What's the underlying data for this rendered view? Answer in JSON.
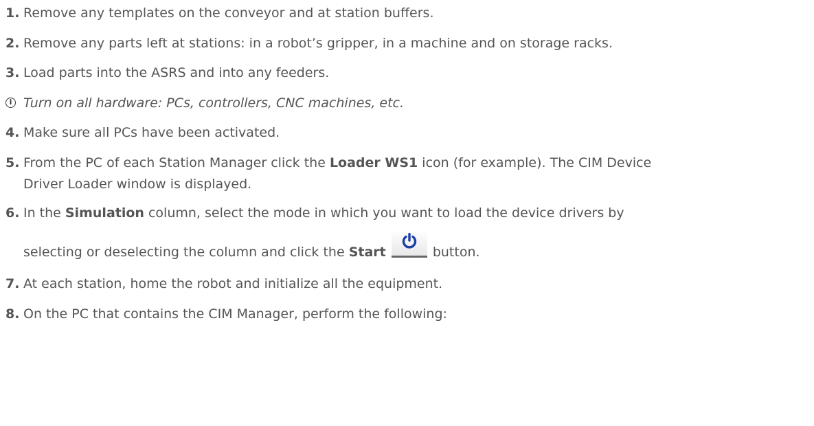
{
  "steps": [
    {
      "num": "1.",
      "text": "Remove any templates on the conveyor and at station buffers."
    },
    {
      "num": "2.",
      "text": "Remove any parts left at stations: in a robot’s gripper, in a machine and on storage racks."
    },
    {
      "num": "3.",
      "text": "Load parts into the ASRS and into any feeders."
    },
    {
      "note": "Turn on all hardware: PCs, controllers, CNC machines, etc.",
      "icon": "info-icon"
    },
    {
      "num": "4.",
      "text": "Make sure all PCs have been activated."
    },
    {
      "num": "5.",
      "text_a": "From the PC of each Station Manager click the ",
      "bold": "Loader WS1",
      "text_b": " icon (for example). The CIM Device",
      "line2": "Driver Loader window is displayed."
    },
    {
      "num": "6.",
      "text_a": "In the ",
      "bold": "Simulation",
      "text_b": " column, select the mode in which you want to load the device drivers by",
      "line2_a": "selecting or deselecting the column and click the ",
      "bold2": "Start",
      "line2_b": " button.",
      "button_icon": "power-icon"
    },
    {
      "num": "7.",
      "text": "At each station, home the robot and initialize all the equipment."
    },
    {
      "num": "8.",
      "text": "On the PC that contains the CIM Manager, perform the following:"
    }
  ],
  "colors": {
    "text": "#555555",
    "power_icon": "#1a3fa8"
  }
}
